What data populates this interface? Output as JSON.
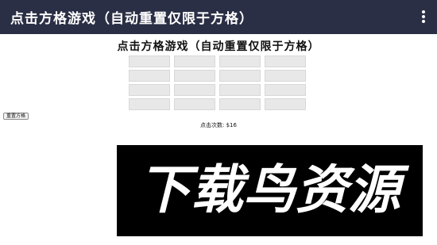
{
  "appbar": {
    "title": "点击方格游戏（自动重置仅限于方格）",
    "menu_icon": "more-vert-icon",
    "background": "#2b2f45"
  },
  "page": {
    "heading": "点击方格游戏（自动重置仅限于方格）"
  },
  "grid": {
    "rows": 4,
    "columns": 4,
    "cell_color": "#e8e8e8"
  },
  "controls": {
    "reset_label": "重置方格"
  },
  "status": {
    "click_count_text": "点击次数: $16"
  },
  "watermark": {
    "text": "下载鸟资源"
  }
}
